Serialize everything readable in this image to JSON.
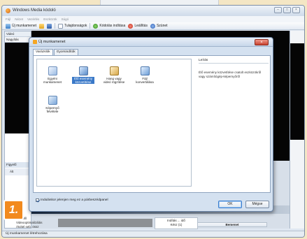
{
  "app": {
    "title": "Windows Media kódoló",
    "menu": [
      "Fájl",
      "Nézet",
      "Vezérlés",
      "Eszközök",
      "Súgó"
    ],
    "toolbar": {
      "new_session": "Új munkamenet",
      "properties": "Tulajdonságok",
      "start_encoding": "Kódolás indítása",
      "stop": "Leállítás",
      "pause": "Szünet"
    },
    "left_panel": {
      "header": "Videó",
      "subheader": "Nagyítás",
      "monitor": "Figyelő",
      "monitor_sub": "Ált"
    },
    "status_text": "Új munkamenet létrehozása",
    "bottom_items": [
      "Új profil",
      "Videooptimalizálás",
      "Átvitel seb. össz"
    ],
    "bottom_field_right_lines": [
      "Indítás ... idő",
      "Kész (1)"
    ],
    "bottom_table_header": "Bemenet"
  },
  "dialog": {
    "title": "Új munkamenet",
    "tabs": [
      "Varázslók",
      "Gyorsindítók"
    ],
    "wizards": [
      {
        "label": "Egyéni munkamenet",
        "icon": "custom-session-icon",
        "selected": false
      },
      {
        "label": "Élő esemény közvetítése",
        "icon": "broadcast-live-icon",
        "selected": true
      },
      {
        "label": "Hang vagy videó rögzítése",
        "icon": "capture-av-icon",
        "selected": false
      },
      {
        "label": "Fájl konvertálása",
        "icon": "convert-file-icon",
        "selected": false
      },
      {
        "label": "Képernyő felvétele",
        "icon": "screen-capture-icon",
        "selected": false
      }
    ],
    "description_header": "Leírás",
    "description_text": "Élő esemény közvetítése csatolt eszközökről vagy számítógép-képernyőről",
    "checkbox_label": "Induláskor jelenjen meg ez a párbeszédpanel",
    "checkbox_checked": true,
    "ok_label": "OK",
    "cancel_label": "Mégse"
  },
  "badge": "1."
}
